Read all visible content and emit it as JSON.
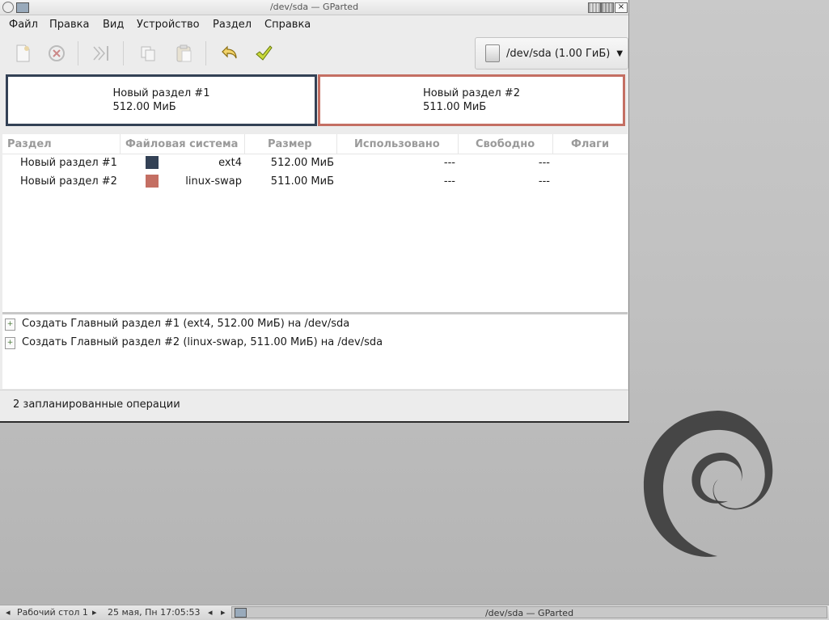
{
  "window": {
    "title": "/dev/sda — GParted"
  },
  "menu": [
    "Файл",
    "Правка",
    "Вид",
    "Устройство",
    "Раздел",
    "Справка"
  ],
  "toolbar": {
    "device_selector": "/dev/sda  (1.00 ГиБ)"
  },
  "diskmap": [
    {
      "name": "Новый раздел #1",
      "size": "512.00 МиБ",
      "color": "#334155"
    },
    {
      "name": "Новый раздел #2",
      "size": "511.00 МиБ",
      "color": "#c46f63"
    }
  ],
  "table": {
    "headers": [
      "Раздел",
      "Файловая система",
      "Размер",
      "Использовано",
      "Свободно",
      "Флаги"
    ],
    "rows": [
      {
        "partition": "Новый раздел #1",
        "fs": "ext4",
        "fs_color": "#334155",
        "size": "512.00 МиБ",
        "used": "---",
        "free": "---",
        "flags": ""
      },
      {
        "partition": "Новый раздел #2",
        "fs": "linux-swap",
        "fs_color": "#c46f63",
        "size": "511.00 МиБ",
        "used": "---",
        "free": "---",
        "flags": ""
      }
    ]
  },
  "operations": [
    "Создать Главный раздел #1 (ext4, 512.00 МиБ) на /dev/sda",
    "Создать Главный раздел #2 (linux-swap, 511.00 МиБ) на /dev/sda"
  ],
  "status": "2 запланированные операции",
  "taskbar": {
    "desktop": "Рабочий стол 1",
    "clock": "25 мая, Пн 17:05:53",
    "window_button": "/dev/sda — GParted"
  }
}
